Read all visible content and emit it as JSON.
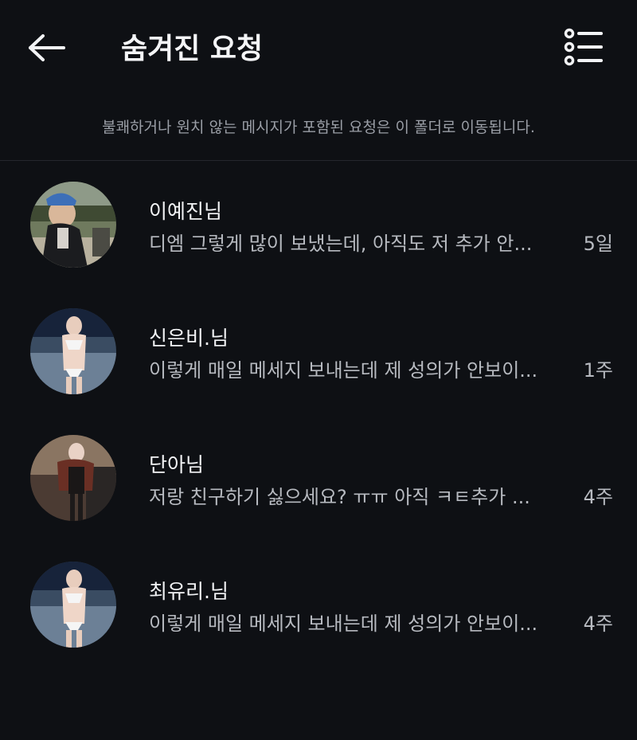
{
  "header": {
    "title": "숨겨진 요청",
    "back_icon": "arrow-left-icon",
    "filter_icon": "filter-list-icon"
  },
  "notice": "불쾌하거나 원치 않는 메시지가 포함된 요청은 이 폴더로 이동됩니다.",
  "requests": [
    {
      "name": "이예진님",
      "preview": "디엠 그렇게 많이 보냈는데, 아직도 저 추가 안...",
      "time": "5일"
    },
    {
      "name": "신은비.님",
      "preview": "이렇게 매일 메세지 보내는데 제 성의가 안보이...",
      "time": "1주"
    },
    {
      "name": "단아님",
      "preview": "저랑 친구하기 싫으세요? ㅠㅠ 아직 ㅋㅌ추가 ...",
      "time": "4주"
    },
    {
      "name": "최유리.님",
      "preview": "이렇게 매일 메세지 보내는데 제 성의가 안보이...",
      "time": "4주"
    }
  ],
  "colors": {
    "background": "#0e1014",
    "primary_text": "#f2f3f5",
    "secondary_text": "#b7bac0"
  }
}
